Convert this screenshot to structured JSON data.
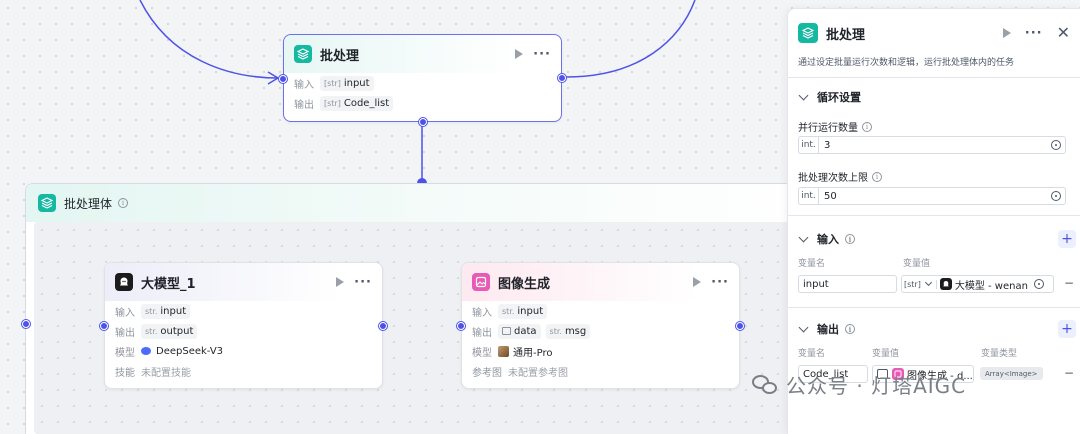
{
  "batch_node": {
    "title": "批处理",
    "input_label": "输入",
    "input_type": "[str]",
    "input_value": "input",
    "output_label": "输出",
    "output_type": "[str]",
    "output_value": "Code_list"
  },
  "group": {
    "title": "批处理体",
    "info": "i"
  },
  "llm_node": {
    "title": "大模型_1",
    "input_label": "输入",
    "input_type": "str.",
    "input_value": "input",
    "output_label": "输出",
    "output_type": "str.",
    "output_value": "output",
    "model_label": "模型",
    "model_value": "DeepSeek-V3",
    "skill_label": "技能",
    "skill_value": "未配置技能"
  },
  "image_node": {
    "title": "图像生成",
    "input_label": "输入",
    "input_type": "str.",
    "input_value": "input",
    "output_label": "输出",
    "output_value_1": "data",
    "output_type_2": "str.",
    "output_value_2": "msg",
    "model_label": "模型",
    "model_value": "通用-Pro",
    "ref_label": "参考图",
    "ref_value": "未配置参考图"
  },
  "panel": {
    "title": "批处理",
    "description": "通过设定批量运行次数和逻辑，运行批处理体内的任务",
    "loop_section": "循环设置",
    "parallel_label": "并行运行数量",
    "parallel_prefix": "int.",
    "parallel_value": "3",
    "max_label": "批处理次数上限",
    "max_prefix": "int.",
    "max_value": "50",
    "input_section": "输入",
    "input_col_name": "变量名",
    "input_col_value": "变量值",
    "input_var_name": "input",
    "input_var_type": "[str]",
    "input_var_ref": "大模型 - wenan",
    "output_section": "输出",
    "output_col_name": "变量名",
    "output_col_value": "变量值",
    "output_col_type": "变量类型",
    "output_var_name": "Code_list",
    "output_var_ref": "图像生成 - d...",
    "output_var_type": "Array<Image>"
  },
  "watermark": "公众号 · 灯塔AIGC",
  "colors": {
    "accent": "#4d53e8",
    "batch_icon": "#15b8a0",
    "image_icon": "#e85ab6",
    "llm_icon": "#1c1c1f"
  }
}
